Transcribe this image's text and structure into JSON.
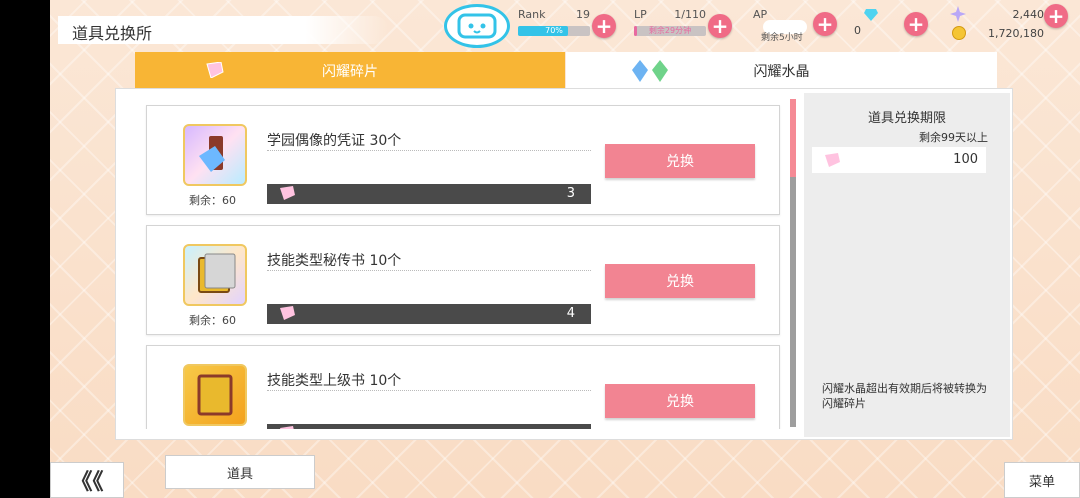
{
  "header": {
    "title": "道具兑换所",
    "rank": {
      "label": "Rank",
      "value": "19",
      "bar_text": "70%",
      "progress": 0.7
    },
    "lp": {
      "label": "LP",
      "value": "1/110",
      "bar_text": "剩余29分钟"
    },
    "ap": {
      "label": "AP",
      "sub": "剩余5小时"
    },
    "diamond_count": "0",
    "star_gems": "2,440",
    "gold": "1,720,180"
  },
  "tabs": [
    {
      "label": "闪耀碎片",
      "active": true
    },
    {
      "label": "闪耀水晶",
      "active": false
    }
  ],
  "items": [
    {
      "name": "学园偶像的凭证 30个",
      "remain_label": "剩余：",
      "remain": "60",
      "cost": "3",
      "button": "兑换"
    },
    {
      "name": "技能类型秘传书 10个",
      "remain_label": "剩余：",
      "remain": "60",
      "cost": "4",
      "button": "兑换"
    },
    {
      "name": "技能类型上级书 10个",
      "remain_label": "剩余：",
      "remain": "",
      "cost": "",
      "button": "兑换"
    }
  ],
  "info": {
    "title": "道具兑换期限",
    "remain": "剩余99天以上",
    "amount": "100",
    "note": "闪耀水晶超出有效期后将被转换为闪耀碎片"
  },
  "bottom": {
    "back": "《《",
    "tab": "道具",
    "menu": "菜单"
  },
  "colors": {
    "accent_tab": "#f8b535",
    "button": "#f28492",
    "plus": "#f06b86",
    "rank_bar": "#33c3e8",
    "lp_bar": "#e86aa0"
  },
  "icons": {
    "gem": "pink-gem-icon",
    "crystals": "blue-green-crystal-icon",
    "plus": "plus-icon",
    "diamond": "diamond-icon",
    "star": "star-gem-icon",
    "coin": "gold-coin-icon"
  }
}
